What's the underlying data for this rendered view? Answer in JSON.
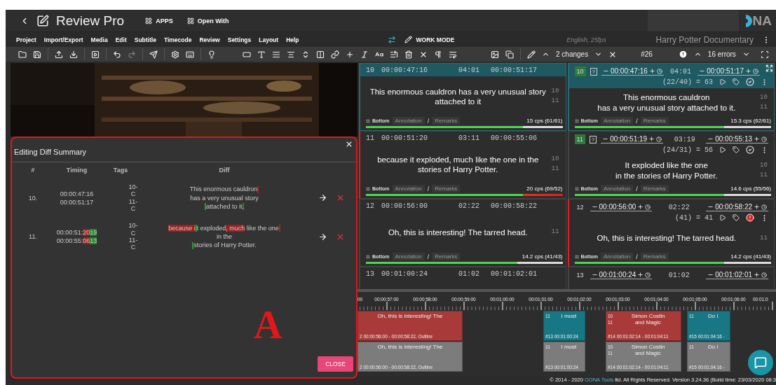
{
  "header": {
    "title": "Review Pro",
    "apps": "APPS",
    "open_with": "Open With",
    "logo": "NA"
  },
  "menu": [
    "Project",
    "Import/Export",
    "Media",
    "Edit",
    "Subtitle",
    "Timecode",
    "Review",
    "Settings",
    "Layout",
    "Help"
  ],
  "mode": {
    "label": "WORK MODE",
    "language": "English, 25fps",
    "project": "Harry Potter Documentary"
  },
  "toolbar": {
    "changes": "2 changes",
    "number": "#26",
    "errors": "16 errors"
  },
  "diff_summary": {
    "title": "Editing Diff Summary",
    "columns": [
      "#",
      "Timing",
      "Tags",
      "Diff"
    ],
    "annotation": "A",
    "close": "CLOSE",
    "rows": [
      {
        "number": "10.",
        "timing": [
          [
            {
              "kind": "same",
              "text": "00:00:47:16"
            }
          ],
          [
            {
              "kind": "same",
              "text": "00:00:51:17"
            }
          ]
        ],
        "tags": [
          "10-C",
          "11-C"
        ],
        "diff": [
          [
            {
              "kind": "same",
              "text": "This enormous cauldron"
            },
            {
              "kind": "removed"
            }
          ],
          [
            {
              "kind": "same",
              "text": "has a very unusual story"
            }
          ],
          [
            {
              "kind": "added"
            },
            {
              "kind": "same",
              "text": "attached to it"
            },
            {
              "kind": "added",
              "text": "."
            }
          ]
        ]
      },
      {
        "number": "11.",
        "timing": [
          [
            {
              "kind": "same",
              "text": "00:00:51:"
            },
            {
              "kind": "removed",
              "text": "20"
            },
            {
              "kind": "added",
              "text": "19"
            }
          ],
          [
            {
              "kind": "same",
              "text": "00:00:55:"
            },
            {
              "kind": "removed",
              "text": "06"
            },
            {
              "kind": "added",
              "text": "13"
            }
          ]
        ],
        "tags": [
          "10-C",
          "11-C"
        ],
        "diff": [
          [
            {
              "kind": "removed",
              "text": "because i"
            },
            {
              "kind": "added"
            },
            {
              "kind": "same",
              "text": "t exploded"
            },
            {
              "kind": "removed",
              "text": ", much"
            },
            {
              "kind": "same",
              "text": " like the one"
            },
            {
              "kind": "removed"
            }
          ],
          [
            {
              "kind": "same",
              "text": "in the"
            }
          ],
          [
            {
              "kind": "added"
            },
            {
              "kind": "same",
              "text": "stories of Harry Potter."
            }
          ]
        ]
      }
    ]
  },
  "subtitles": [
    {
      "selected": true,
      "source": {
        "error": false,
        "number": "10",
        "start": "00:00:47:16",
        "duration": "04:01",
        "end": "00:00:51:17",
        "lines": [
          "This enormous cauldron has a very unusual story",
          "attached to it"
        ],
        "line_numbers": [
          "10",
          "11"
        ],
        "position": "Bottom",
        "annotation": "Annotation",
        "separator": "/",
        "remarks": "Remarks",
        "cps": "15 cps (61/61)",
        "level": 0.8,
        "over": false
      },
      "target": {
        "error": false,
        "number": "10",
        "marked": true,
        "query": "?",
        "start": "00:00:47:16",
        "duration": "04:01",
        "end": "00:00:51:17",
        "stats": "(22/40) = 63",
        "kind": "ok",
        "lines": [
          "This enormous cauldron",
          "has a very unusual story attached to it."
        ],
        "line_numbers": [
          "10",
          "11"
        ],
        "position": "Bottom",
        "annotation": "Annotation",
        "separator": "/",
        "remarks": "Remarks",
        "cps": "15.3 cps (62/61)",
        "level": 0.76,
        "over": false
      }
    },
    {
      "selected": false,
      "source": {
        "error": true,
        "number": "11",
        "start": "00:00:51:20",
        "duration": "03:11",
        "end": "00:00:55:06",
        "lines": [
          "because it exploded, much like the one in the",
          "stories of Harry Potter."
        ],
        "line_numbers": [
          "10",
          "11"
        ],
        "position": "Bottom",
        "annotation": "Annotation",
        "separator": "/",
        "remarks": "Remarks",
        "cps": "20 cps (69/52)",
        "level": 0.8,
        "over": true
      },
      "target": {
        "error": false,
        "number": "11",
        "marked": true,
        "query": "?",
        "start": "00:00:51:19",
        "duration": "03:19",
        "end": "00:00:55:13",
        "stats": "(24/31) = 56",
        "kind": "ok",
        "lines": [
          "It exploded like the one",
          "in the stories of Harry Potter."
        ],
        "line_numbers": [
          "10",
          "11"
        ],
        "position": "Bottom",
        "annotation": "Annotation",
        "separator": "/",
        "remarks": "Remarks",
        "cps": "14.6 cps (55/56)",
        "level": 0.76,
        "over": false
      }
    },
    {
      "selected": false,
      "source": {
        "error": false,
        "number": "12",
        "start": "00:00:56:00",
        "duration": "02:22",
        "end": "00:00:58:22",
        "lines": [
          "Oh, this is interesting! The tarred head."
        ],
        "line_numbers": [
          "11"
        ],
        "position": "Bottom",
        "annotation": "Annotation",
        "separator": "/",
        "remarks": "Remarks",
        "cps": "14.2 cps (41/43)",
        "level": 0.77,
        "over": false
      },
      "target": {
        "error": true,
        "number": "12",
        "marked": false,
        "start": "00:00:56:00",
        "duration": "02:22",
        "end": "00:00:58:22",
        "stats": "(41) = 41",
        "kind": "error",
        "lines": [
          "Oh, this is interesting! The tarred head."
        ],
        "line_numbers": [
          "11"
        ],
        "position": "Bottom",
        "annotation": "Annotation",
        "separator": "/",
        "remarks": "Remarks",
        "cps": "14.2 cps (41/43)",
        "level": 0.76,
        "over": false
      }
    },
    {
      "selected": false,
      "source": {
        "error": false,
        "number": "13",
        "start": "00:01:00:24",
        "duration": "01:02",
        "end": "00:01:02:01"
      },
      "target": {
        "error": false,
        "number": "13",
        "marked": false,
        "start": "00:01:00:24",
        "duration": "01:02",
        "end": "00:01:02:01"
      }
    }
  ],
  "timeline": {
    "ticks": [
      "00",
      "00:00:57:00",
      "00:00:58:00",
      "00:00:59:00",
      "00:01:00:00",
      "00:01:01:00",
      "00:01:02:00",
      "00:01:03:00",
      "00:01:04:00",
      "00:01:05:00",
      "00:01:06:00",
      "00:01:0"
    ],
    "tracks": [
      {
        "clips": [
          {
            "color": "#a83a3a",
            "lines": [
              {
                "text": "Oh, this is interesting! The"
              }
            ],
            "info": "2 00:00:56:00 - 00:00:58:22, Outline"
          },
          {
            "color": "#177784",
            "lines": [
              {
                "number": "11",
                "text": "I most"
              }
            ],
            "info": "#13 00:01:00:24"
          },
          {
            "color": "#a83a3a",
            "lines": [
              {
                "number": "10",
                "text": "Simon Costin"
              },
              {
                "number": "11",
                "text": "and Magic"
              }
            ],
            "info": "#14 00:01:02:14 - 00:01:04:11"
          },
          {
            "color": "#177784",
            "lines": [
              {
                "number": "11",
                "text": "Do I"
              }
            ],
            "info": "#15 00:01:04:16 -"
          }
        ]
      },
      {
        "clips": [
          {
            "color": "#7c7c7c",
            "lines": [
              {
                "text": "Oh, this is interesting! The"
              }
            ],
            "info": "2 00:00:56:00 - 00:00:58:22, Outline"
          },
          {
            "color": "#7c7c7c",
            "lines": [
              {
                "number": "11",
                "text": "I most"
              }
            ],
            "info": "#13 00:01:00:24"
          },
          {
            "color": "#7c7c7c",
            "lines": [
              {
                "number": "10",
                "text": "Simon Costin"
              },
              {
                "number": "11",
                "text": "and Magic"
              }
            ],
            "info": "#14 00:01:02:14 - 00:01:04:11"
          },
          {
            "color": "#7c7c7c",
            "lines": [
              {
                "number": "11",
                "text": "Do I"
              }
            ],
            "info": "#15 00:01:04:16 -"
          }
        ]
      }
    ]
  },
  "footer": {
    "prefix": "© 2014 - 2020",
    "brand": "OONA Tools",
    "suffix": "ltd. All Rights Reserved. Version 3.24.36 (Build time: 23/03/2020 08:3"
  }
}
